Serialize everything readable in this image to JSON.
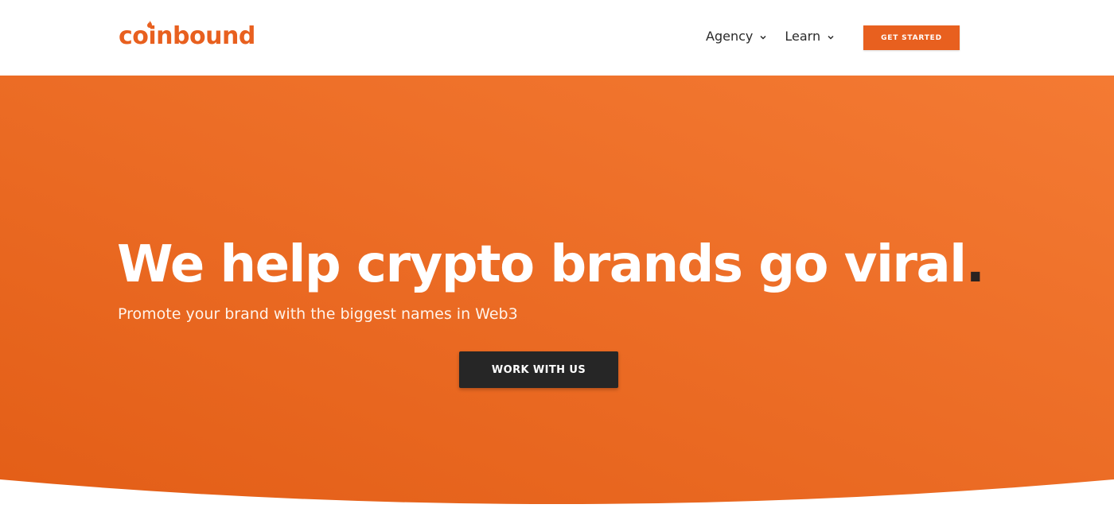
{
  "header": {
    "logo_text": "coinbound",
    "nav": [
      {
        "label": "Agency",
        "icon": "chevron-down-icon"
      },
      {
        "label": "Learn",
        "icon": "chevron-down-icon"
      }
    ],
    "cta_label": "GET STARTED"
  },
  "hero": {
    "title": "We help crypto brands go viral",
    "title_punct": ".",
    "subtitle": "Promote your brand with the biggest names in Web3",
    "cta_label": "WORK WITH US"
  },
  "colors": {
    "brand_orange": "#e8601f",
    "hero_gradient_start": "#f47a33",
    "hero_gradient_end": "#e35e17",
    "dark_button": "#262626",
    "text_dark": "#2a2a2a"
  }
}
